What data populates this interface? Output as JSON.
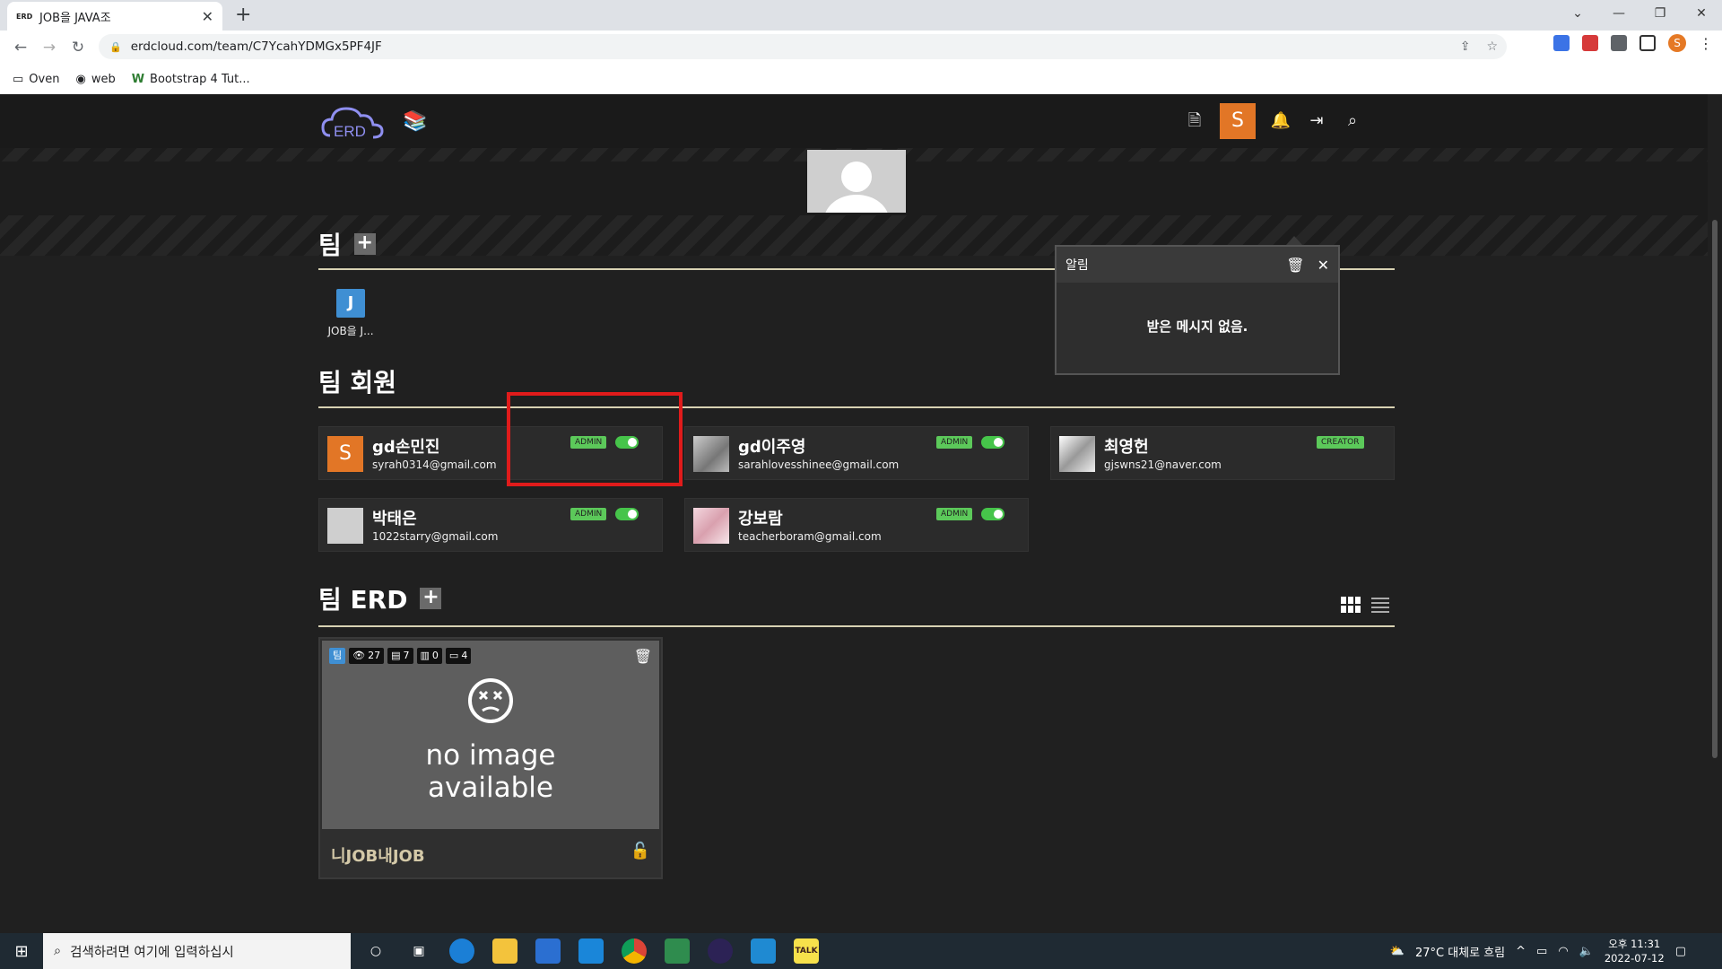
{
  "browser": {
    "tab_title": "JOB을 JAVA조",
    "tab_favicon": "ERD",
    "url": "erdcloud.com/team/C7YcahYDMGx5PF4JF",
    "bookmarks": [
      "Oven",
      "web",
      "Bootstrap 4 Tut..."
    ],
    "profile_initial": "S"
  },
  "navbar": {
    "logo_text": "ERD",
    "user_initial": "S"
  },
  "teams_section": {
    "title": "팀",
    "teams": [
      {
        "initial": "J",
        "label": "JOB을 J..."
      }
    ]
  },
  "members_section": {
    "title": "팀 회원",
    "members": [
      {
        "name": "gd손민진",
        "email": "syrah0314@gmail.com",
        "role": "ADMIN",
        "avatar": "S"
      },
      {
        "name": "gd이주영",
        "email": "sarahlovesshinee@gmail.com",
        "role": "ADMIN",
        "avatar": ""
      },
      {
        "name": "최영헌",
        "email": "gjswns21@naver.com",
        "role": "CREATOR",
        "avatar": ""
      },
      {
        "name": "박태은",
        "email": "1022starry@gmail.com",
        "role": "ADMIN",
        "avatar": ""
      },
      {
        "name": "강보람",
        "email": "teacherboram@gmail.com",
        "role": "ADMIN",
        "avatar": ""
      }
    ]
  },
  "erd_section": {
    "title": "팀 ERD",
    "cards": [
      {
        "team_tag": "팀",
        "views": "27",
        "tables": "7",
        "members": "0",
        "comments": "4",
        "placeholder_line1": "no image",
        "placeholder_line2": "available",
        "name": "니JOB내JOB"
      }
    ]
  },
  "notification": {
    "title": "알림",
    "empty_message": "받은 메시지 없음."
  },
  "taskbar": {
    "search_placeholder": "검색하려면 여기에 입력하십시",
    "weather": "27°C  대체로 흐림",
    "time": "오후 11:31",
    "date": "2022-07-12"
  },
  "colors": {
    "accent_orange": "#e27626",
    "admin_green": "#5cc95a",
    "team_blue": "#3f8fd3",
    "highlight_red": "#e01b1b"
  }
}
